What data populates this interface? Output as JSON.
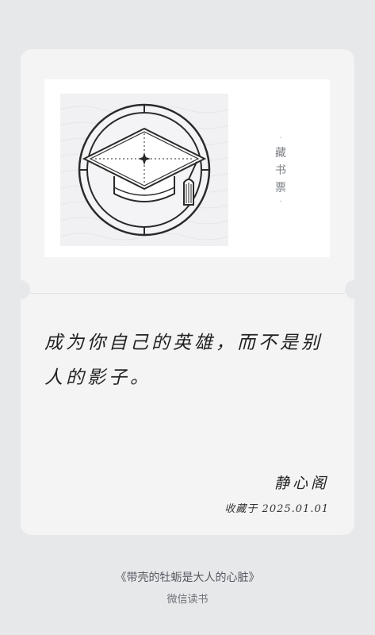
{
  "card": {
    "stamp_label": {
      "dot_top": "·",
      "chars": [
        "藏",
        "书",
        "票"
      ],
      "dot_bottom": "·"
    },
    "quote": "成为你自己的英雄，而不是别人的影子。",
    "author": "静心阁",
    "collected": "收藏于 2025.01.01"
  },
  "footer": {
    "book_title": "《带壳的牡蛎是大人的心脏》",
    "app_name": "微信读书"
  },
  "icons": {
    "stamp_image": "graduation-cap-icon"
  },
  "colors": {
    "page_bg": "#e7e8ea",
    "card_bg": "#f4f4f5",
    "stamp_bg": "#ffffff",
    "ink": "#222222"
  }
}
